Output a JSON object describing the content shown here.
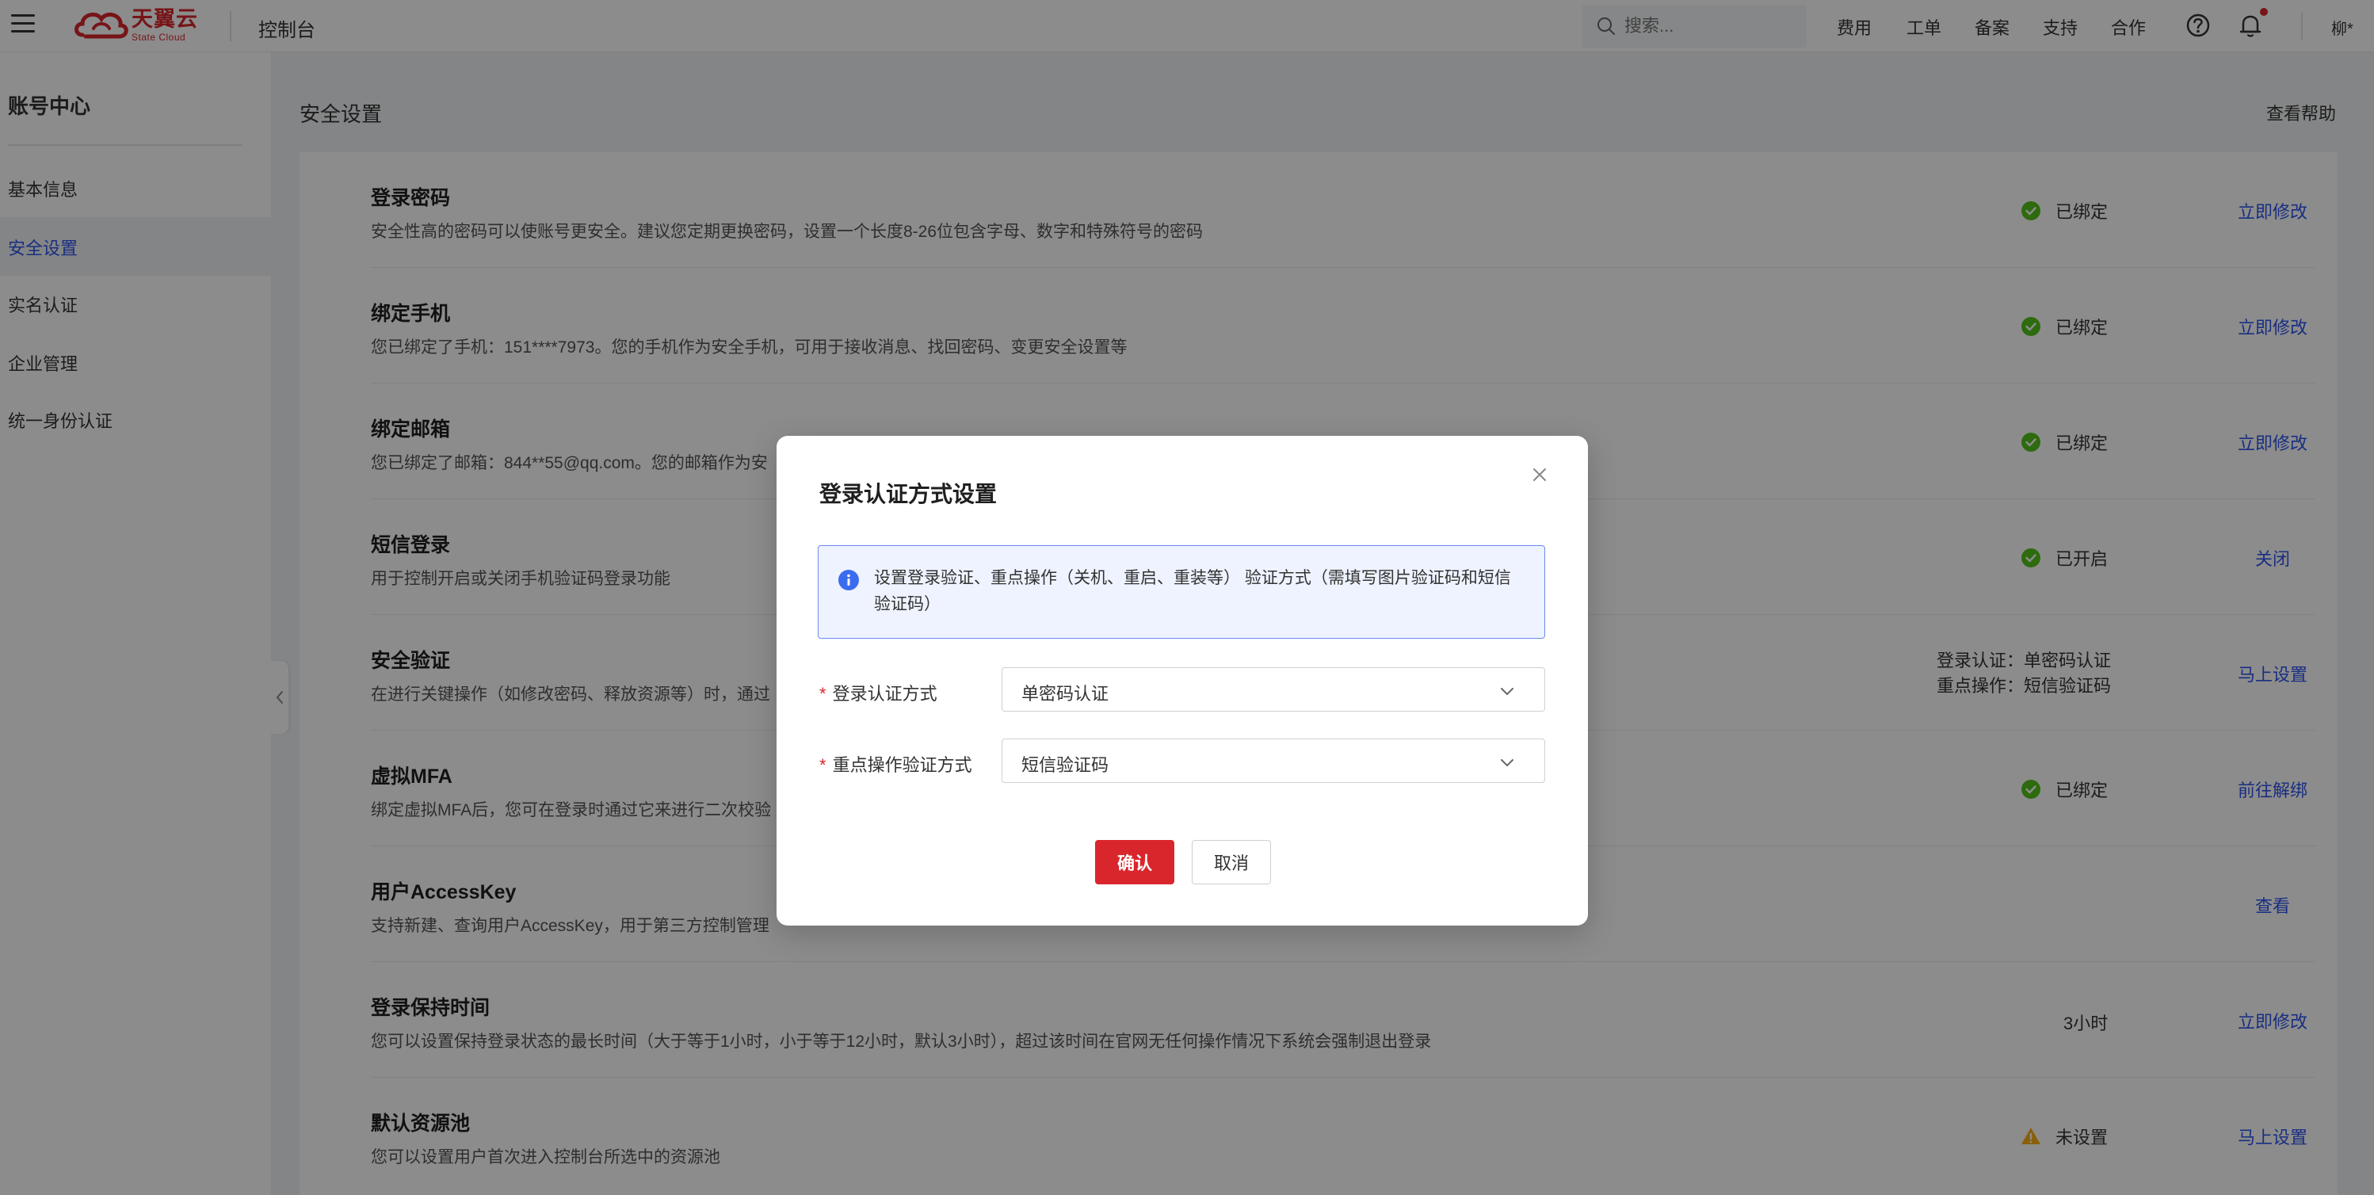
{
  "header": {
    "logo_cn": "天翼云",
    "logo_en": "State Cloud",
    "console_title": "控制台",
    "search_placeholder": "搜索...",
    "nav": [
      "费用",
      "工单",
      "备案",
      "支持",
      "合作"
    ],
    "user": "柳*"
  },
  "sidebar": {
    "title": "账号中心",
    "items": [
      {
        "label": "基本信息"
      },
      {
        "label": "安全设置",
        "active": true
      },
      {
        "label": "实名认证"
      },
      {
        "label": "企业管理"
      },
      {
        "label": "统一身份认证"
      }
    ]
  },
  "main": {
    "title": "安全设置",
    "help": "查看帮助",
    "rows": [
      {
        "title": "登录密码",
        "desc": "安全性高的密码可以使账号更安全。建议您定期更换密码，设置一个长度8-26位包含字母、数字和特殊符号的密码",
        "status": "已绑定",
        "status_icon": "check-circle-icon",
        "action": "立即修改"
      },
      {
        "title": "绑定手机",
        "desc": "您已绑定了手机：151****7973。您的手机作为安全手机，可用于接收消息、找回密码、变更安全设置等",
        "status": "已绑定",
        "status_icon": "check-circle-icon",
        "action": "立即修改"
      },
      {
        "title": "绑定邮箱",
        "desc": "您已绑定了邮箱：844**55@qq.com。您的邮箱作为安",
        "status": "已绑定",
        "status_icon": "check-circle-icon",
        "action": "立即修改"
      },
      {
        "title": "短信登录",
        "desc": "用于控制开启或关闭手机验证码登录功能",
        "status": "已开启",
        "status_icon": "check-circle-icon",
        "action": "关闭"
      },
      {
        "title": "安全验证",
        "desc": "在进行关键操作（如修改密码、释放资源等）时，通过",
        "status_lines": [
          "登录认证：单密码认证",
          "重点操作：短信验证码"
        ],
        "action": "马上设置"
      },
      {
        "title": "虚拟MFA",
        "desc": "绑定虚拟MFA后，您可在登录时通过它来进行二次校验",
        "status": "已绑定",
        "status_icon": "check-circle-icon",
        "action": "前往解绑"
      },
      {
        "title": "用户AccessKey",
        "desc": "支持新建、查询用户AccessKey，用于第三方控制管理",
        "action": "查看"
      },
      {
        "title": "登录保持时间",
        "desc": "您可以设置保持登录状态的最长时间（大于等于1小时，小于等于12小时，默认3小时），超过该时间在官网无任何操作情况下系统会强制退出登录",
        "status": "3小时",
        "action": "立即修改"
      },
      {
        "title": "默认资源池",
        "desc": "您可以设置用户首次进入控制台所选中的资源池",
        "status": "未设置",
        "status_icon": "warning-icon",
        "action": "马上设置"
      }
    ]
  },
  "modal": {
    "title": "登录认证方式设置",
    "info": "设置登录验证、重点操作（关机、重启、重装等） 验证方式（需填写图片验证码和短信验证码）",
    "fields": [
      {
        "label": "登录认证方式",
        "value": "单密码认证"
      },
      {
        "label": "重点操作验证方式",
        "value": "短信验证码"
      }
    ],
    "confirm": "确认",
    "cancel": "取消"
  },
  "colors": {
    "brand": "#d9262c",
    "link": "#2f54eb",
    "success": "#52c41a",
    "warning": "#faad14"
  }
}
